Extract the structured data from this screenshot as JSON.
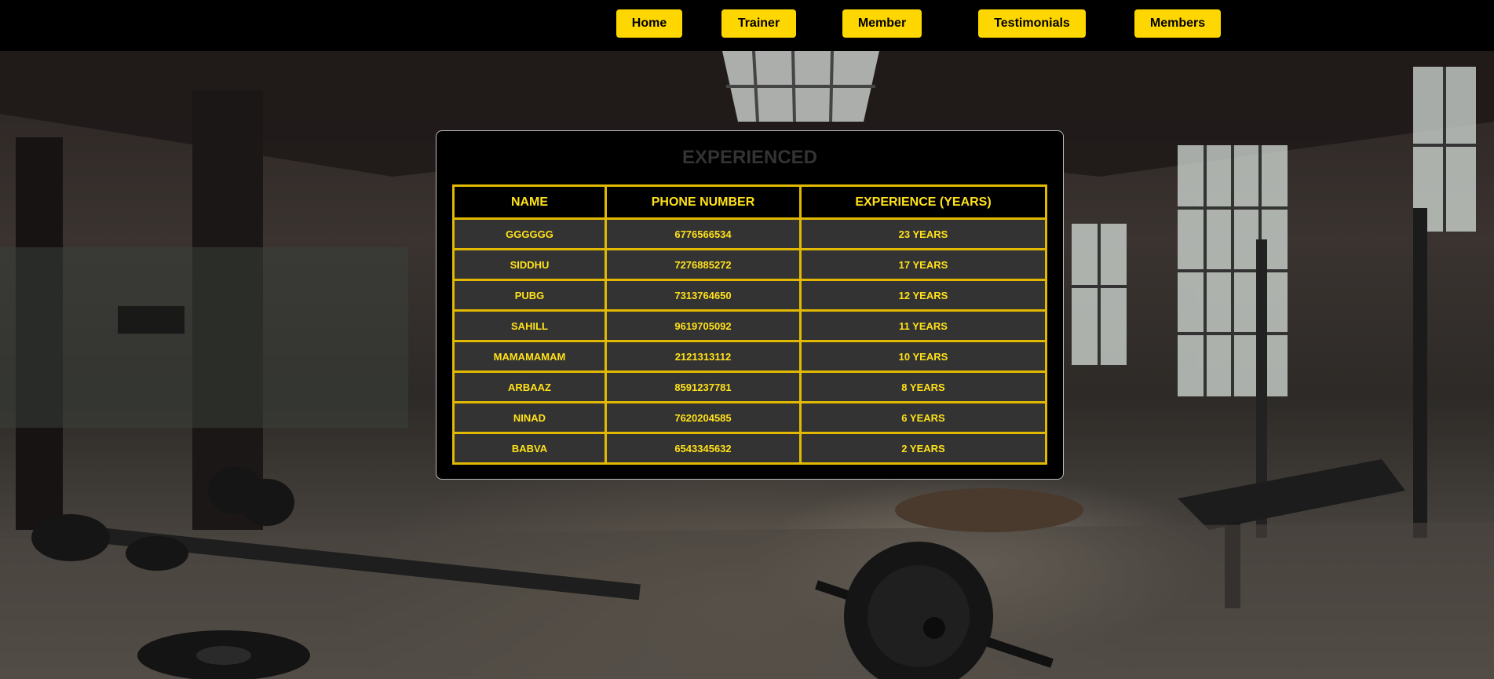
{
  "nav": {
    "items": [
      {
        "label": "Home"
      },
      {
        "label": "Trainer"
      },
      {
        "label": "Member"
      },
      {
        "label": "Testimonials"
      },
      {
        "label": "Members"
      }
    ]
  },
  "panel": {
    "title": "EXPERIENCED",
    "table": {
      "headers": [
        "NAME",
        "PHONE NUMBER",
        "EXPERIENCE (YEARS)"
      ],
      "rows": [
        [
          "GGGGGG",
          "6776566534",
          "23 YEARS"
        ],
        [
          "SIDDHU",
          "7276885272",
          "17 YEARS"
        ],
        [
          "PUBG",
          "7313764650",
          "12 YEARS"
        ],
        [
          "SAHILL",
          "9619705092",
          "11 YEARS"
        ],
        [
          "MAMAMAMAM",
          "2121313112",
          "10 YEARS"
        ],
        [
          "ARBAAZ",
          "8591237781",
          "8 YEARS"
        ],
        [
          "NINAD",
          "7620204585",
          "6 YEARS"
        ],
        [
          "BABVA",
          "6543345632",
          "2 YEARS"
        ]
      ]
    }
  },
  "colors": {
    "accent": "#ffd700",
    "table_border": "#e2b900",
    "table_text": "#ffe11a",
    "cell_bg": "#333333",
    "nav_bg": "#000000"
  },
  "background": {
    "description_icon": "gym-background-image"
  }
}
